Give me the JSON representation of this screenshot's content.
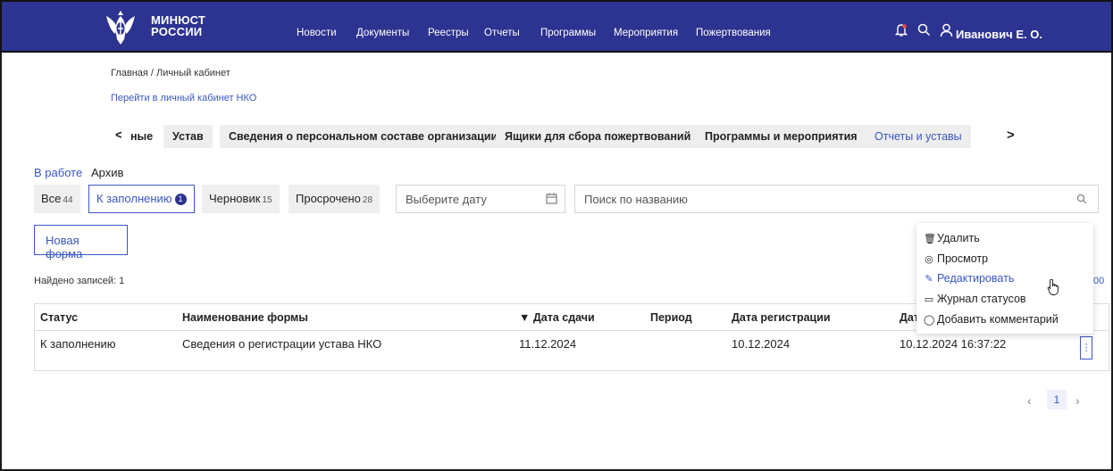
{
  "header": {
    "logo_line1": "МИНЮСТ",
    "logo_line2": "РОССИИ",
    "nav": [
      "Новости",
      "Документы",
      "Реестры",
      "Отчеты",
      "Программы",
      "Мероприятия",
      "Пожертвования"
    ],
    "user_name": "Иванович Е. О.",
    "icons": [
      "bell-icon",
      "search-icon",
      "user-icon"
    ],
    "bg_color": "#2d3390"
  },
  "breadcrumb": "Главная / Личный кабинет",
  "nko_link": "Перейти в личный кабинет НКО",
  "sections": {
    "tabs": [
      "ные",
      "Устав",
      "Сведения о персональном составе организации",
      "Ящики для сбора пожертвований",
      "Программы и мероприятия",
      "Отчеты и уставы"
    ],
    "active": "Отчеты и уставы",
    "prev_icon": "chevron-left-icon",
    "next_icon": "chevron-right-icon"
  },
  "modes": {
    "work": "В работе",
    "archive": "Архив"
  },
  "filters": {
    "all": {
      "label": "Все",
      "count": "44"
    },
    "to_fill": {
      "label": "К заполнению",
      "count": "1"
    },
    "draft": {
      "label": "Черновик",
      "count": "15"
    },
    "overdue": {
      "label": "Просрочено",
      "count": "28"
    },
    "date_placeholder": "Выберите дату",
    "search_placeholder": "Поиск по названию"
  },
  "new_form_label": "Новая форма",
  "found_label": "Найдено записей: 1",
  "page_size_partial": "00",
  "table": {
    "headers": [
      "Статус",
      "Наименование формы",
      "▼ Дата сдачи",
      "Период",
      "Дата регистрации",
      "Дат"
    ],
    "rows": [
      [
        "К заполнению",
        "Сведения о регистрации устава НКО",
        "11.12.2024",
        "",
        "10.12.2024",
        "10.12.2024 16:37:22"
      ]
    ],
    "row_menu": "⋮"
  },
  "row_actions": [
    {
      "label": "Удалить",
      "icon": "trash-icon"
    },
    {
      "label": "Просмотр",
      "icon": "eye-icon"
    },
    {
      "label": "Редактировать",
      "icon": "pencil-icon"
    },
    {
      "label": "Журнал статусов",
      "icon": "book-icon"
    },
    {
      "label": "Добавить комментарий",
      "icon": "comment-icon"
    }
  ],
  "pagination": {
    "current": "1"
  },
  "accent_color": "#3a56c4"
}
